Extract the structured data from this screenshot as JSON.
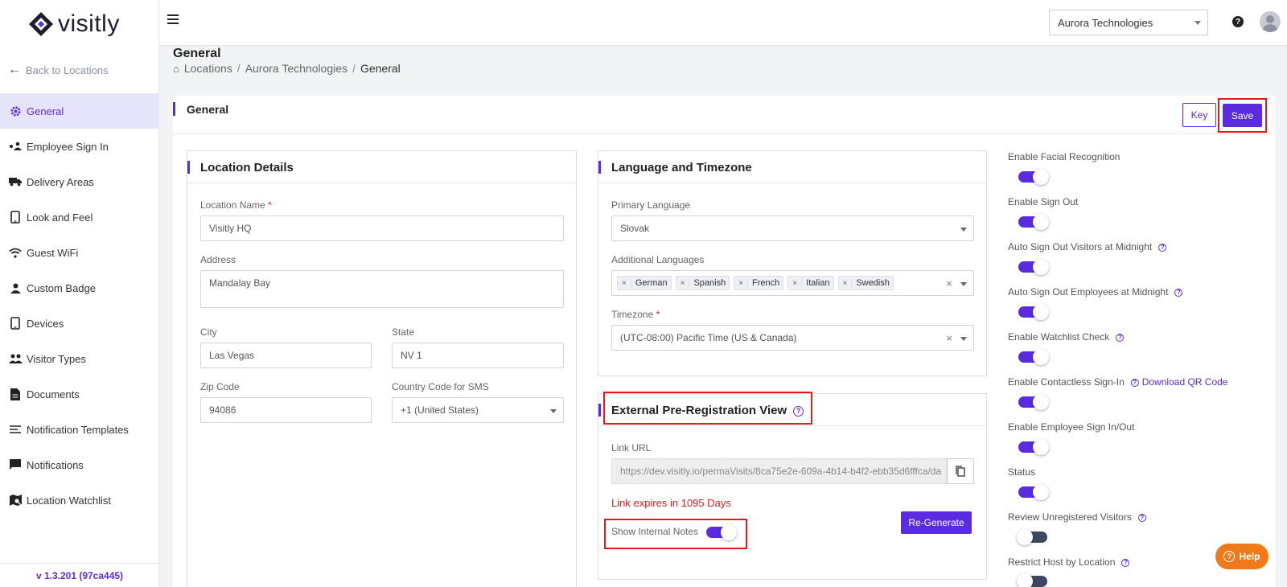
{
  "app": {
    "logo_text": "visitly",
    "version": "v 1.3.201 (97ca445)"
  },
  "sidebar": {
    "back_label": "Back to Locations",
    "items": [
      {
        "label": "General",
        "icon": "gear-icon",
        "active": true
      },
      {
        "label": "Employee Sign In",
        "icon": "employee-signin-icon"
      },
      {
        "label": "Delivery Areas",
        "icon": "truck-icon"
      },
      {
        "label": "Look and Feel",
        "icon": "tablet-icon"
      },
      {
        "label": "Guest WiFi",
        "icon": "wifi-icon"
      },
      {
        "label": "Custom Badge",
        "icon": "person-icon"
      },
      {
        "label": "Devices",
        "icon": "device-icon"
      },
      {
        "label": "Visitor Types",
        "icon": "people-icon"
      },
      {
        "label": "Documents",
        "icon": "document-icon"
      },
      {
        "label": "Notification Templates",
        "icon": "list-icon"
      },
      {
        "label": "Notifications",
        "icon": "chat-icon"
      },
      {
        "label": "Location Watchlist",
        "icon": "watchlist-icon"
      }
    ]
  },
  "topbar": {
    "org": "Aurora Technologies"
  },
  "page": {
    "title": "General",
    "breadcrumb": [
      "Locations",
      "Aurora Technologies",
      "General"
    ]
  },
  "card": {
    "title": "General",
    "key_label": "Key",
    "save_label": "Save"
  },
  "location": {
    "title": "Location Details",
    "name_label": "Location Name",
    "name_value": "Visitly HQ",
    "address_label": "Address",
    "address_value": "Mandalay Bay",
    "city_label": "City",
    "city_value": "Las Vegas",
    "state_label": "State",
    "state_value": "NV 1",
    "zip_label": "Zip Code",
    "zip_value": "94086",
    "country_label": "Country Code for SMS",
    "country_value": "+1 (United States)"
  },
  "language": {
    "title": "Language and Timezone",
    "primary_label": "Primary Language",
    "primary_value": "Slovak",
    "additional_label": "Additional Languages",
    "additional_values": [
      "German",
      "Spanish",
      "French",
      "Italian",
      "Swedish"
    ],
    "timezone_label": "Timezone",
    "timezone_value": "(UTC-08:00) Pacific Time (US & Canada)"
  },
  "prereg": {
    "title": "External Pre-Registration View",
    "link_label": "Link URL",
    "link_value": "https://dev.visitly.io/permaVisits/8ca75e2e-609a-4b14-b4f2-ebb35d6fffca/da",
    "expires": "Link expires in 1095 Days",
    "regen_label": "Re-Generate",
    "notes_label": "Show Internal Notes",
    "notes_on": true
  },
  "settings": [
    {
      "label": "Enable Facial Recognition",
      "on": true,
      "help": false
    },
    {
      "label": "Enable Sign Out",
      "on": true,
      "help": false
    },
    {
      "label": "Auto Sign Out Visitors at Midnight",
      "on": true,
      "help": true
    },
    {
      "label": "Auto Sign Out Employees at Midnight",
      "on": true,
      "help": true
    },
    {
      "label": "Enable Watchlist Check",
      "on": true,
      "help": true
    },
    {
      "label": "Enable Contactless Sign-In",
      "on": true,
      "help": true,
      "link": "Download QR Code"
    },
    {
      "label": "Enable Employee Sign In/Out",
      "on": true,
      "help": false
    },
    {
      "label": "Status",
      "on": true,
      "help": false
    },
    {
      "label": "Review Unregistered Visitors",
      "on": false,
      "help": true
    },
    {
      "label": "Restrict Host by Location",
      "on": false,
      "help": true
    }
  ],
  "help_fab": {
    "label": "Help"
  },
  "colors": {
    "accent": "#5b2be0",
    "danger": "#e01c1c",
    "help": "#f07a1a"
  }
}
